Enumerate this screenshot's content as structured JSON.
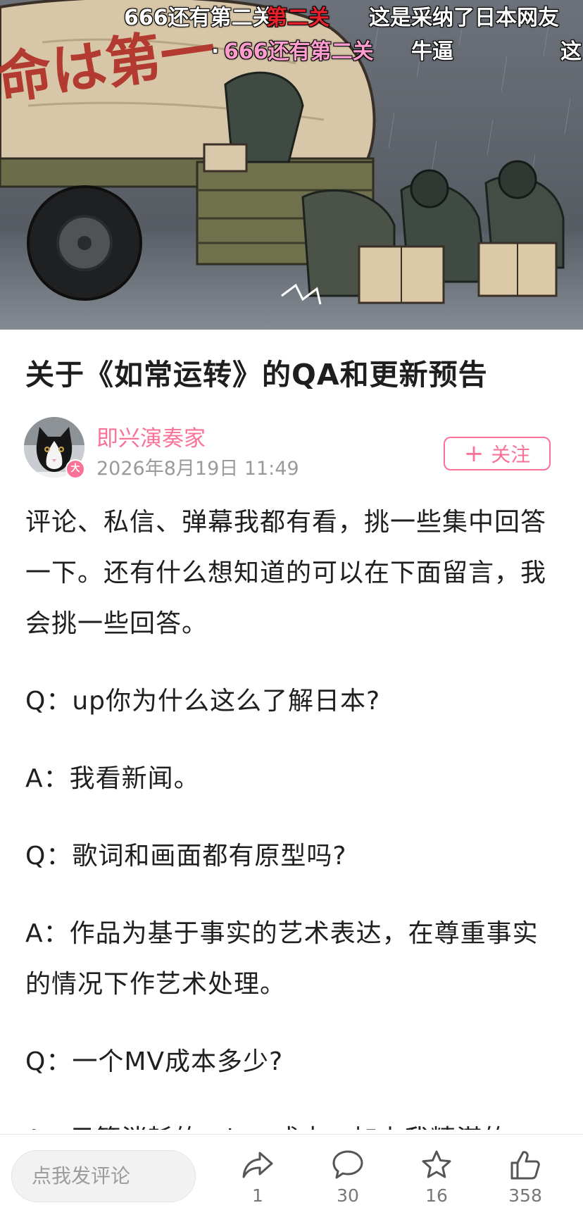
{
  "video": {
    "banner_text": "命は第一",
    "danmaku": [
      {
        "text": "666还有第二关",
        "style": "white"
      },
      {
        "text": "第二关",
        "style": "red"
      },
      {
        "text": "这是采纳了日本网友",
        "style": "white"
      },
      {
        "text": ".",
        "style": "white"
      },
      {
        "text": "666还有第二关",
        "style": "pink"
      },
      {
        "text": "牛逼",
        "style": "white"
      },
      {
        "text": "这",
        "style": "white"
      }
    ]
  },
  "article": {
    "title": "关于《如常运转》的QA和更新预告",
    "author": {
      "name": "即兴演奏家",
      "badge": "大",
      "time": "2026年8月19日 11:49"
    },
    "follow_label": "关注",
    "paragraphs": [
      "评论、私信、弹幕我都有看，挑一些集中回答一下。还有什么想知道的可以在下面留言，我会挑一些回答。",
      "Q：up你为什么这么了解日本?",
      "A：我看新闻。",
      "Q：歌词和画面都有原型吗?",
      "A：作品为基于事实的艺术表达，在尊重事实的情况下作艺术处理。",
      "Q：一个MV成本多少?",
      "A：只算消耗的token成本，加上我精湛的"
    ]
  },
  "bottom_bar": {
    "comment_placeholder": "点我发评论",
    "share": {
      "icon": "share-icon",
      "count": "1"
    },
    "comment": {
      "icon": "comment-icon",
      "count": "30"
    },
    "favorite": {
      "icon": "star-icon",
      "count": "16"
    },
    "like": {
      "icon": "thumbs-up-icon",
      "count": "358"
    }
  },
  "colors": {
    "accent": "#fb7299",
    "text": "#1f1f1f",
    "muted": "#9a9a9a"
  }
}
